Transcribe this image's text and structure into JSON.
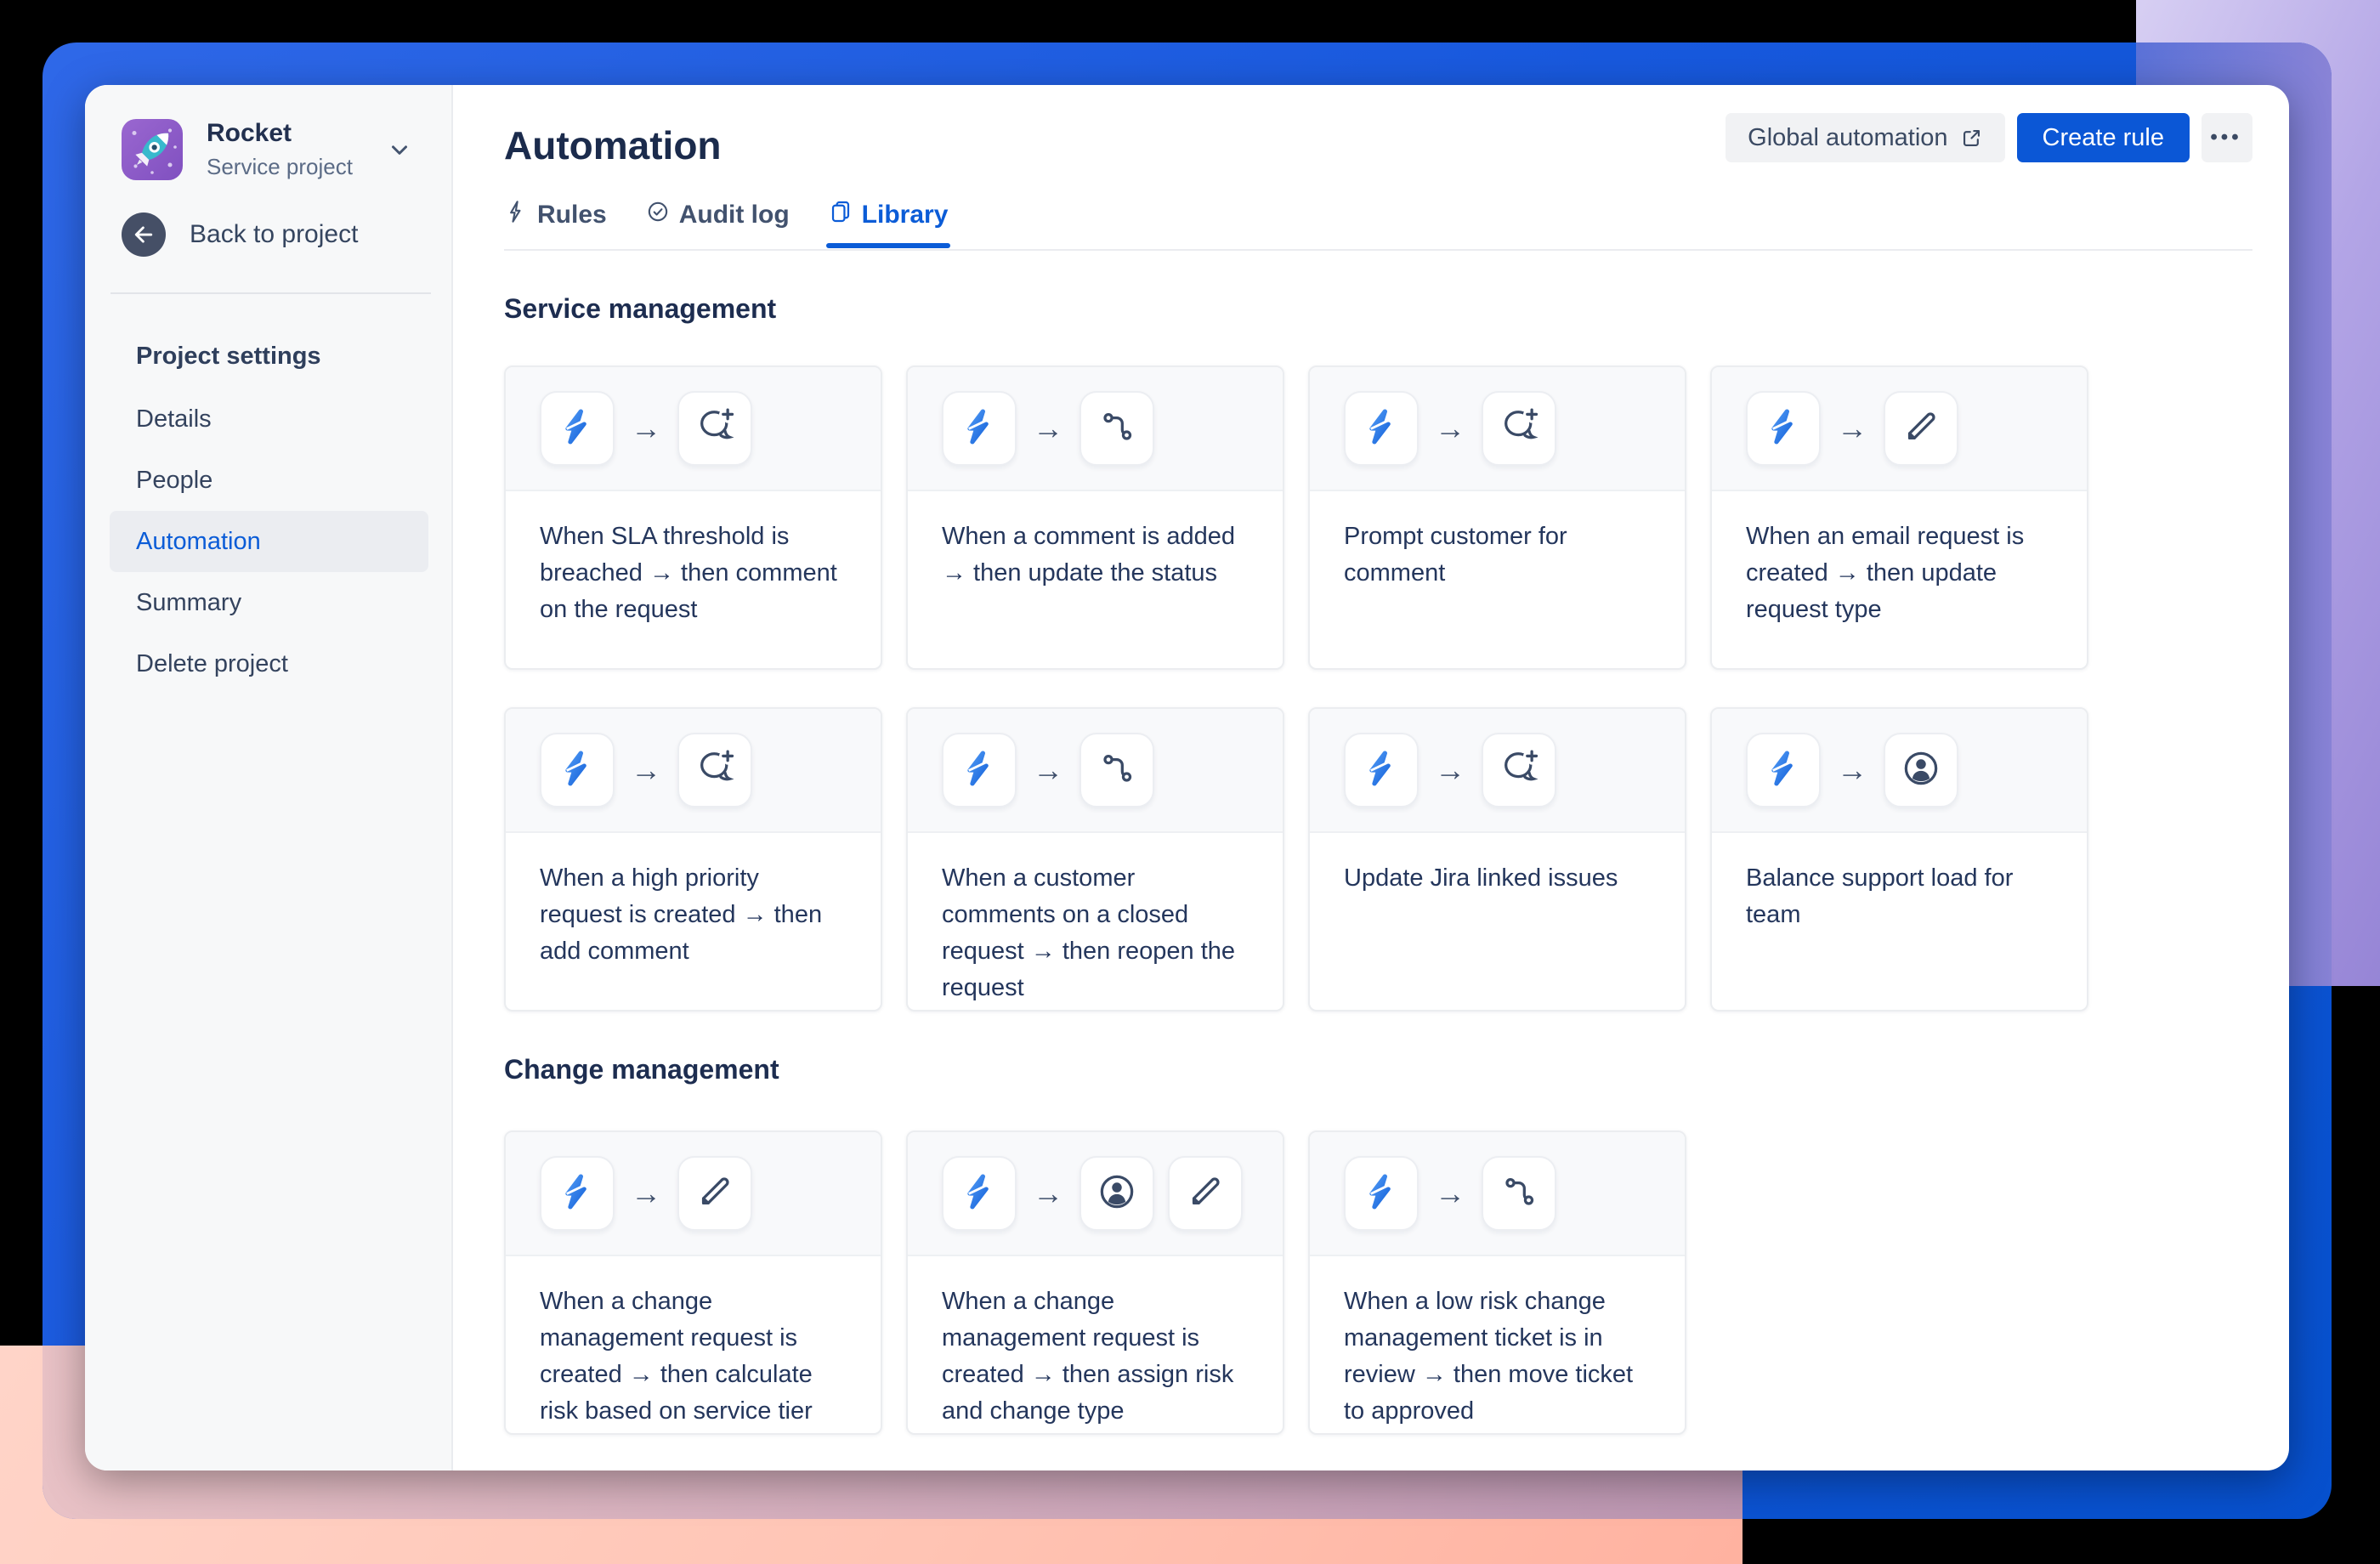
{
  "colors": {
    "accent_blue": "#0b57d6",
    "frame_blue": "#1859de",
    "background_purple": "#a895e0",
    "background_peach": "#ffc4b4",
    "avatar_purple": "#8d59c9",
    "text_dark": "#1b2b4c"
  },
  "sidebar": {
    "project": {
      "name": "Rocket",
      "type": "Service project"
    },
    "back_label": "Back to project",
    "heading": "Project settings",
    "items": [
      {
        "label": "Details",
        "active": false
      },
      {
        "label": "People",
        "active": false
      },
      {
        "label": "Automation",
        "active": true
      },
      {
        "label": "Summary",
        "active": false
      },
      {
        "label": "Delete project",
        "active": false
      }
    ]
  },
  "header": {
    "title": "Automation",
    "global_button": "Global automation",
    "create_button": "Create rule",
    "more_label": "•••"
  },
  "tabs": [
    {
      "label": "Rules",
      "icon": "lightning-outline-icon",
      "active": false
    },
    {
      "label": "Audit log",
      "icon": "check-circle-icon",
      "active": false
    },
    {
      "label": "Library",
      "icon": "copy-pages-icon",
      "active": true
    }
  ],
  "sections": [
    {
      "title": "Service management",
      "cards": [
        {
          "text": "When SLA threshold is breached → then comment on the request",
          "icons": [
            "automation-bolt-icon",
            "comment-add-icon"
          ]
        },
        {
          "text": "When a comment is added → then update the status",
          "icons": [
            "automation-bolt-icon",
            "branch-icon"
          ]
        },
        {
          "text": "Prompt customer for comment",
          "icons": [
            "automation-bolt-icon",
            "comment-add-icon"
          ]
        },
        {
          "text": "When an email request is created → then update request type",
          "icons": [
            "automation-bolt-icon",
            "edit-pencil-icon"
          ]
        },
        {
          "text": "When a high priority request is created → then add comment",
          "icons": [
            "automation-bolt-icon",
            "comment-add-icon"
          ]
        },
        {
          "text": "When a customer comments on a closed request → then reopen the request",
          "icons": [
            "automation-bolt-icon",
            "branch-icon"
          ]
        },
        {
          "text": "Update Jira linked issues",
          "icons": [
            "automation-bolt-icon",
            "comment-add-icon"
          ]
        },
        {
          "text": "Balance support load for team",
          "icons": [
            "automation-bolt-icon",
            "person-circle-icon"
          ]
        }
      ]
    },
    {
      "title": "Change management",
      "cards": [
        {
          "text": "When a change management request is created → then calculate risk based on service tier",
          "icons": [
            "automation-bolt-icon",
            "edit-pencil-icon"
          ]
        },
        {
          "text": "When a change management request is created → then assign risk and change type",
          "icons": [
            "automation-bolt-icon",
            "person-circle-icon",
            "edit-pencil-icon"
          ]
        },
        {
          "text": "When a low risk change management ticket is in review → then move ticket to approved",
          "icons": [
            "automation-bolt-icon",
            "branch-icon"
          ]
        }
      ]
    }
  ]
}
